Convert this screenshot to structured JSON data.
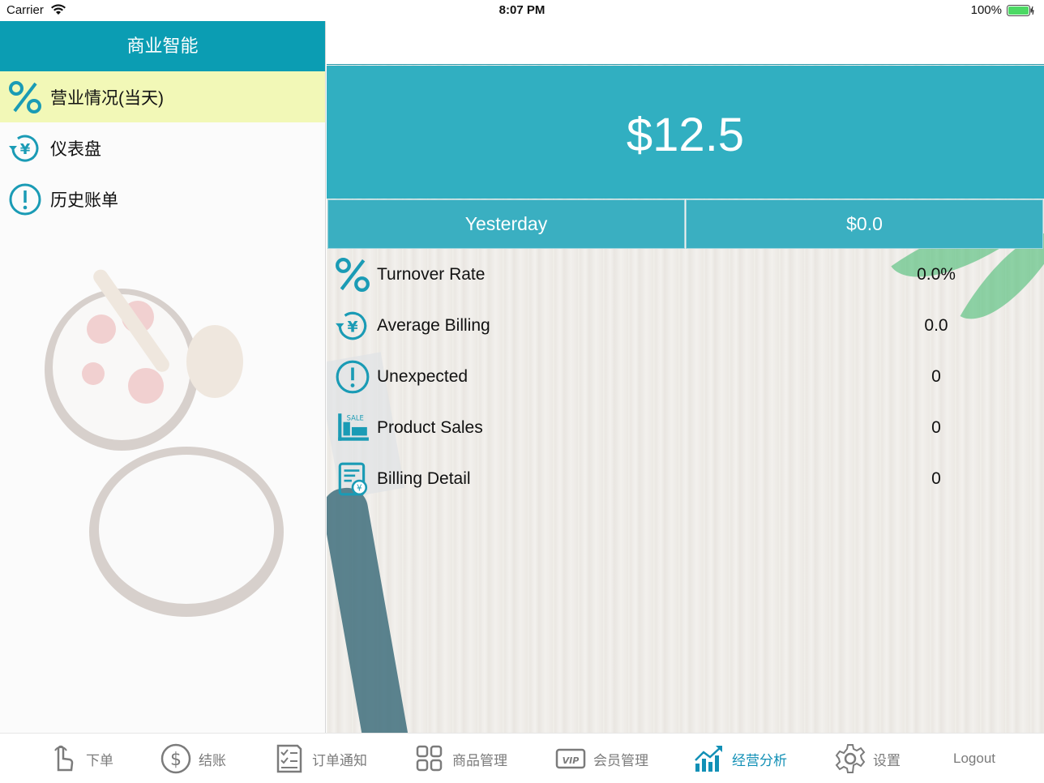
{
  "status_bar": {
    "carrier": "Carrier",
    "time": "8:07 PM",
    "battery": "100%"
  },
  "sidebar": {
    "title": "商业智能",
    "items": [
      {
        "label": "营业情况(当天)",
        "icon": "percent-icon",
        "active": true
      },
      {
        "label": "仪表盘",
        "icon": "yen-refresh-icon",
        "active": false
      },
      {
        "label": "历史账单",
        "icon": "exclamation-circle-icon",
        "active": false
      }
    ]
  },
  "main": {
    "total": "$12.5",
    "yesterday_label": "Yesterday",
    "yesterday_value": "$0.0",
    "rows": [
      {
        "label": "Turnover Rate",
        "value": "0.0%",
        "icon": "percent-icon"
      },
      {
        "label": "Average Billing",
        "value": "0.0",
        "icon": "yen-refresh-icon"
      },
      {
        "label": "Unexpected",
        "value": "0",
        "icon": "exclamation-circle-icon"
      },
      {
        "label": "Product Sales",
        "value": "0",
        "icon": "sale-chart-icon"
      },
      {
        "label": "Billing Detail",
        "value": "0",
        "icon": "invoice-yen-icon"
      }
    ]
  },
  "tabbar": {
    "tabs": [
      {
        "label": "下单",
        "icon": "hand-tap-icon",
        "active": false
      },
      {
        "label": "结账",
        "icon": "dollar-circle-icon",
        "active": false
      },
      {
        "label": "订单通知",
        "icon": "checklist-icon",
        "active": false
      },
      {
        "label": "商品管理",
        "icon": "grid-icon",
        "active": false
      },
      {
        "label": "会员管理",
        "icon": "vip-card-icon",
        "active": false
      },
      {
        "label": "经营分析",
        "icon": "trend-chart-icon",
        "active": true
      },
      {
        "label": "设置",
        "icon": "gear-icon",
        "active": false
      },
      {
        "label": "Logout",
        "icon": "",
        "active": false
      }
    ]
  },
  "colors": {
    "accent": "#0b9db3",
    "hero": "#31afc1",
    "active_item_bg": "#f2f8b7",
    "active_tab": "#1290b6",
    "inactive_tab": "#7b7b7b"
  }
}
